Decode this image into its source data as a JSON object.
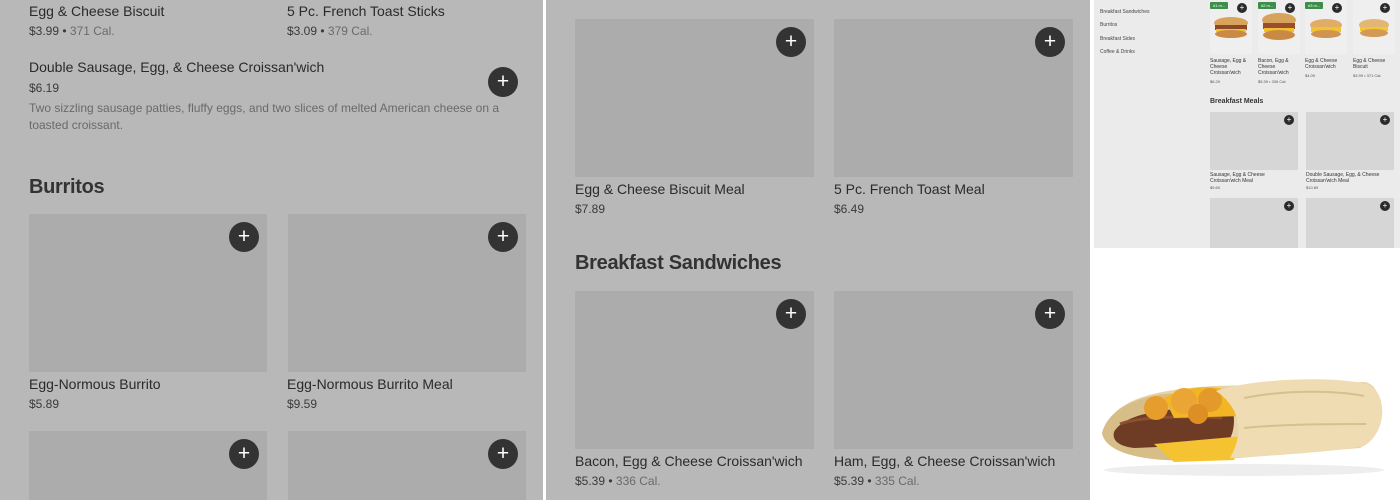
{
  "left": {
    "top_items": [
      {
        "name": "Egg & Cheese Biscuit",
        "price": "$3.99",
        "cal": "371 Cal."
      },
      {
        "name": "5 Pc. French Toast Sticks",
        "price": "$3.09",
        "cal": "379 Cal."
      }
    ],
    "featured": {
      "name": "Double Sausage, Egg, & Cheese Croissan'wich",
      "price": "$6.19",
      "description": "Two sizzling sausage patties, fluffy eggs, and two slices of melted American cheese on a toasted croissant."
    },
    "section_title": "Burritos",
    "cards": [
      {
        "name": "Egg-Normous Burrito",
        "price": "$5.89"
      },
      {
        "name": "Egg-Normous Burrito Meal",
        "price": "$9.59"
      }
    ],
    "plus_glyph": "+"
  },
  "middle": {
    "cards_top": [
      {
        "name": "Egg & Cheese Biscuit Meal",
        "price": "$7.89"
      },
      {
        "name": "5 Pc. French Toast Meal",
        "price": "$6.49"
      }
    ],
    "section_title": "Breakfast Sandwiches",
    "cards_bottom": [
      {
        "name": "Bacon, Egg & Cheese Croissan'wich",
        "price": "$5.39",
        "cal": "336 Cal."
      },
      {
        "name": "Ham, Egg, & Cheese Croissan'wich",
        "price": "$5.39",
        "cal": "335 Cal."
      }
    ]
  },
  "right": {
    "sidebar": [
      "Breakfast Sandwiches",
      "Burritos",
      "Breakfast Sides",
      "Coffee & Drinks"
    ],
    "top_row": [
      {
        "badge": "#1 m...",
        "name": "Sausage, Egg & Cheese Croissan'wich",
        "price": "$6.29"
      },
      {
        "badge": "#2 m...",
        "name": "Bacon, Egg & Cheese Croissan'wich",
        "price": "$5.39 • 336 Cal."
      },
      {
        "badge": "#3 m...",
        "name": "Egg & Cheese Croissan'wich",
        "price": "$4.09"
      },
      {
        "badge": "",
        "name": "Egg & Cheese Biscuit",
        "price": "$3.99 • 371 Cal."
      }
    ],
    "section_title": "Breakfast Meals",
    "meals": [
      {
        "name": "Sausage, Egg & Cheese Croissan'wich Meal",
        "price": "$9.69"
      },
      {
        "name": "Double Sausage, Egg, & Cheese Croissan'wich Meal",
        "price": "$10.89"
      }
    ]
  },
  "colors": {
    "overlay": "#b8b8b8",
    "plus_button": "#333333",
    "badge_green": "#3b8f4a"
  },
  "icons": {
    "add": "plus-icon"
  }
}
